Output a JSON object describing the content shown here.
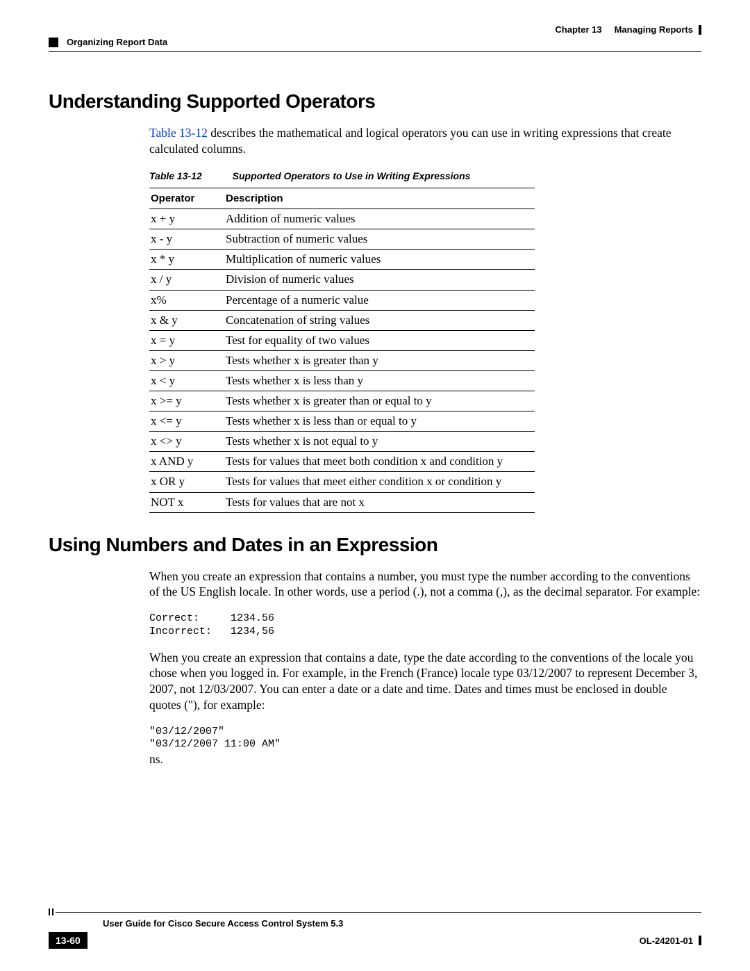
{
  "header": {
    "chapter_label": "Chapter 13",
    "chapter_title": "Managing Reports",
    "section_breadcrumb": "Organizing Report Data"
  },
  "section1": {
    "heading": "Understanding Supported Operators",
    "intro_link": "Table 13-12",
    "intro_rest": " describes the mathematical and logical operators you can use in writing expressions that create calculated columns.",
    "table_caption_num": "Table 13-12",
    "table_caption_text": "Supported Operators to Use in Writing Expressions",
    "col1": "Operator",
    "col2": "Description",
    "rows": [
      {
        "op": "x + y",
        "desc": "Addition of numeric values"
      },
      {
        "op": "x - y",
        "desc": "Subtraction of numeric values"
      },
      {
        "op": "x * y",
        "desc": "Multiplication of numeric values"
      },
      {
        "op": "x / y",
        "desc": "Division of numeric values"
      },
      {
        "op": "x%",
        "desc": "Percentage of a numeric value"
      },
      {
        "op": "x & y",
        "desc": "Concatenation of string values"
      },
      {
        "op": "x = y",
        "desc": "Test for equality of two values"
      },
      {
        "op": "x > y",
        "desc": "Tests whether x is greater than y"
      },
      {
        "op": "x < y",
        "desc": "Tests whether x is less than y"
      },
      {
        "op": "x >= y",
        "desc": "Tests whether x is greater than or equal to y"
      },
      {
        "op": "x <= y",
        "desc": "Tests whether x is less than or equal to y"
      },
      {
        "op": "x <> y",
        "desc": "Tests whether x is not equal to y"
      },
      {
        "op": "x AND y",
        "desc": "Tests for values that meet both condition x and condition y"
      },
      {
        "op": "x OR y",
        "desc": "Tests for values that meet either condition x or condition y"
      },
      {
        "op": "NOT x",
        "desc": "Tests for values that are not x"
      }
    ]
  },
  "section2": {
    "heading": "Using Numbers and Dates in an Expression",
    "para1": "When you create an expression that contains a number, you must type the number according to the conventions of the US English locale. In other words, use a period (.), not a comma (,), as the decimal separator. For example:",
    "code1": "Correct:     1234.56\nIncorrect:   1234,56",
    "para2": "When you create an expression that contains a date, type the date according to the conventions of the locale you chose when you logged in. For example, in the French (France) locale type 03/12/2007 to represent December 3, 2007, not 12/03/2007. You can enter a date or a date and time. Dates and times must be enclosed in double quotes (\"), for example:",
    "code2": "\"03/12/2007\"\n\"03/12/2007 11:00 AM\"",
    "trailing": "ns."
  },
  "footer": {
    "guide": "User Guide for Cisco Secure Access Control System 5.3",
    "pagenum": "13-60",
    "docid": "OL-24201-01"
  }
}
